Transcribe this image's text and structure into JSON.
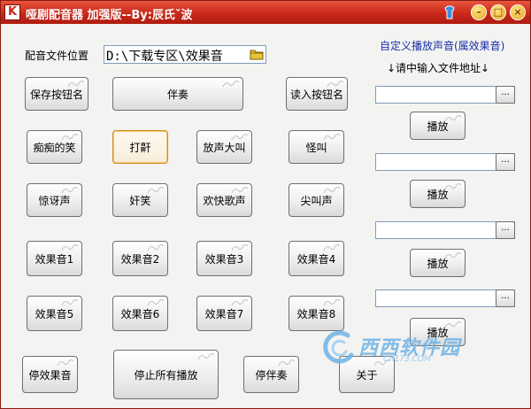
{
  "window": {
    "title": "哑剧配音器 加强版--By:辰氏ˇ波",
    "app_icon_letter": "K"
  },
  "location": {
    "label": "配音文件位置",
    "path": "D:\\下载专区\\效果音"
  },
  "buttons": {
    "save_name": "保存按钮名",
    "accompany": "伴奏",
    "read_name": "读入按钮名",
    "silly_laugh": "痴痴的笑",
    "snore": "打鼾",
    "shout": "放声大叫",
    "weird_cry": "怪叫",
    "surprised": "惊讶声",
    "sly_laugh": "奸笑",
    "happy_song": "欢快歌声",
    "scream": "尖叫声",
    "effect1": "效果音1",
    "effect2": "效果音2",
    "effect3": "效果音3",
    "effect4": "效果音4",
    "effect5": "效果音5",
    "effect6": "效果音6",
    "effect7": "效果音7",
    "effect8": "效果音8",
    "stop_effect": "停效果音",
    "stop_all": "停止所有播放",
    "stop_accompany": "停伴奏",
    "about": "关于"
  },
  "custom": {
    "title": "自定义播放声音(属效果音)",
    "hint": "↓请中输入文件地址↓",
    "browse_label": "...",
    "play_label": "播放",
    "fields": [
      "",
      "",
      "",
      ""
    ]
  },
  "watermark": {
    "text": "西西软件园",
    "sub": "CR173.COM"
  },
  "colors": {
    "titlebar": "#c8281a",
    "accent_text": "#1a2fa8"
  }
}
